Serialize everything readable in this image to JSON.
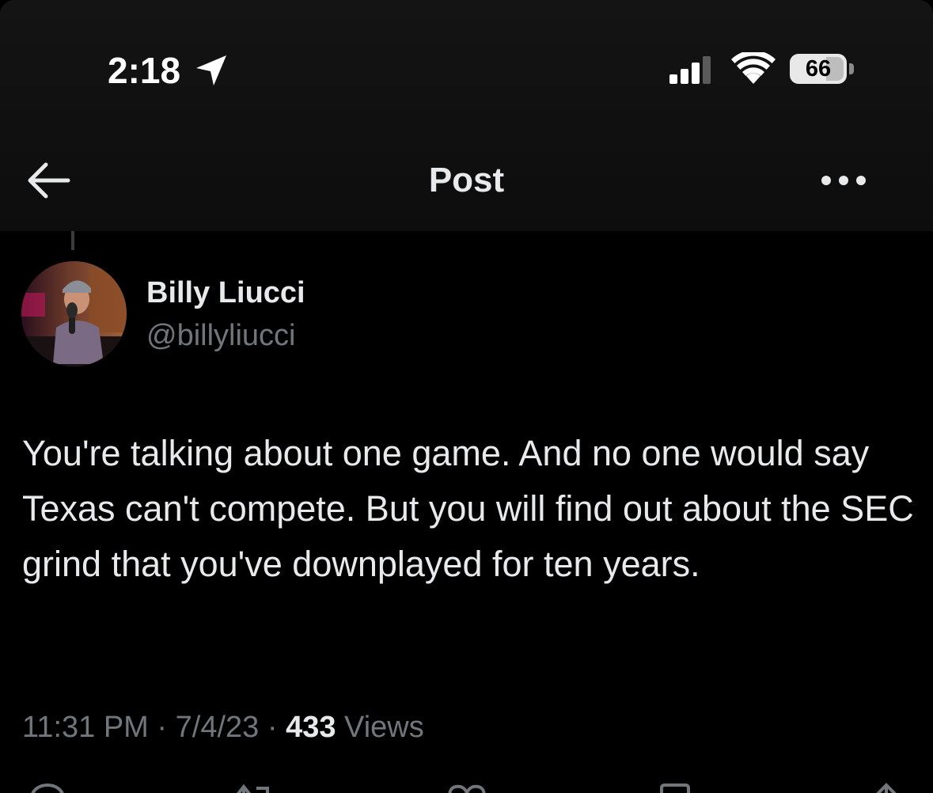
{
  "status_bar": {
    "time": "2:18",
    "battery": "66"
  },
  "header": {
    "title": "Post"
  },
  "post": {
    "author_name": "Billy Liucci",
    "author_handle": "@billyliucci",
    "text": "You're talking about one game. And no one would say Texas can't compete. But you will find out about the SEC grind that you've downplayed for ten years.",
    "time": "11:31 PM",
    "separator": "·",
    "date": "7/4/23",
    "views_count": "433",
    "views_label": "Views"
  },
  "icons": {
    "back": "arrow-left-icon",
    "more": "ellipsis-icon",
    "location": "location-arrow-icon",
    "signal": "cellular-signal-icon",
    "wifi": "wifi-icon",
    "battery": "battery-icon",
    "actions": [
      "reply-icon",
      "repost-icon",
      "like-icon",
      "bookmark-icon",
      "share-icon"
    ]
  },
  "colors": {
    "background": "#000000",
    "header_background": "#121212",
    "primary_text": "#e7e9ea",
    "secondary_text": "#71767b"
  }
}
